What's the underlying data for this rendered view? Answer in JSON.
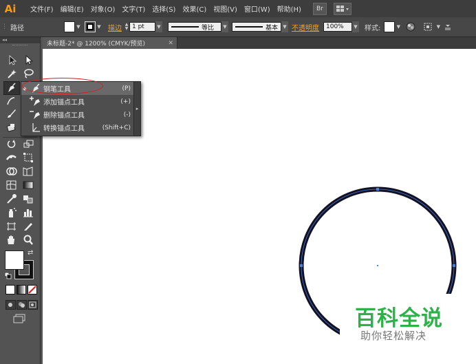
{
  "app": {
    "logo": "Ai"
  },
  "menubar": {
    "items": [
      "文件(F)",
      "编辑(E)",
      "对象(O)",
      "文字(T)",
      "选择(S)",
      "效果(C)",
      "视图(V)",
      "窗口(W)",
      "帮助(H)"
    ],
    "br_label": "Br"
  },
  "control": {
    "selection_label": "路径",
    "stroke_link": "描边",
    "stroke_weight": "1 pt",
    "profile_label": "等比",
    "brush_label": "基本",
    "opacity_link": "不透明度",
    "opacity_value": "100%",
    "style_label": "样式:"
  },
  "document": {
    "tab_title": "未标题-2* @ 1200% (CMYK/预览)"
  },
  "flyout": {
    "items": [
      {
        "label": "钢笔工具",
        "shortcut": "(P)",
        "icon": "pen-icon"
      },
      {
        "label": "添加锚点工具",
        "shortcut": "(+)",
        "icon": "add-anchor-icon"
      },
      {
        "label": "删除锚点工具",
        "shortcut": "(-)",
        "icon": "delete-anchor-icon"
      },
      {
        "label": "转换锚点工具",
        "shortcut": "(Shift+C)",
        "icon": "convert-anchor-icon"
      }
    ]
  },
  "watermark": {
    "title": "百科全说",
    "subtitle": "助你轻松解决"
  },
  "colors": {
    "accent": "#ff9a00",
    "annotation": "#d12020",
    "watermark": "#2db24a",
    "path_anchor": "#4f7fd6"
  }
}
